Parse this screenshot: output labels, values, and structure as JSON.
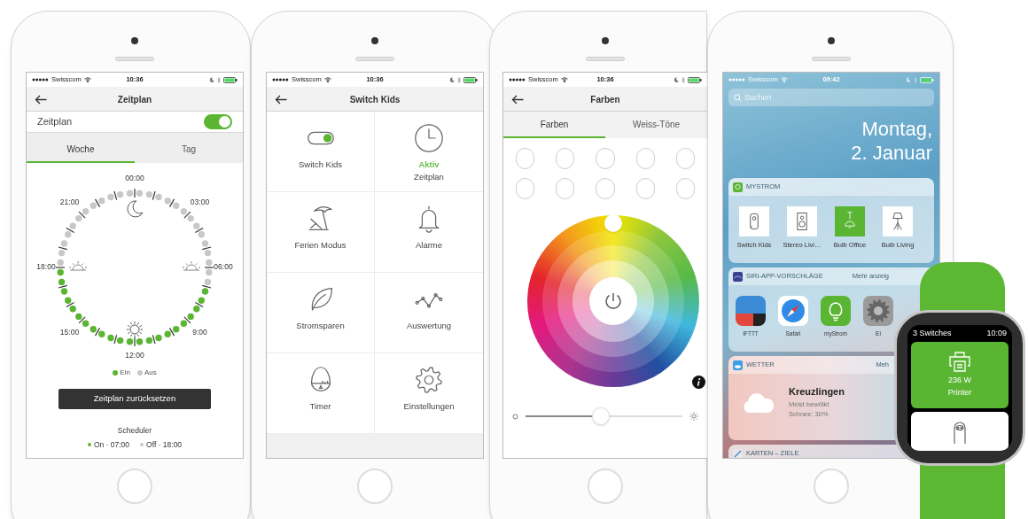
{
  "phones": [
    {
      "kind": "schedule",
      "status": {
        "carrier": "Swisscom",
        "time": "10:36"
      },
      "title": "Zeitplan",
      "toggle": {
        "label": "Zeitplan",
        "on": true
      },
      "tabs": [
        {
          "label": "Woche",
          "selected": true
        },
        {
          "label": "Tag",
          "selected": false
        }
      ],
      "clock": {
        "labels": [
          "00:00",
          "03:00",
          "06:00",
          "9:00",
          "12:00",
          "15:00",
          "18:00",
          "21:00"
        ],
        "slots": [
          false,
          false,
          false,
          false,
          false,
          false,
          false,
          false,
          false,
          false,
          false,
          false,
          false,
          false,
          true,
          true,
          true,
          true,
          true,
          true,
          true,
          true,
          true,
          true,
          true,
          true,
          true,
          true,
          true,
          true,
          true,
          true,
          true,
          true,
          true,
          true,
          false,
          false,
          false,
          false,
          false,
          false,
          false,
          false,
          false,
          false,
          false,
          false
        ]
      },
      "legend": [
        {
          "label": "Ein",
          "color": "#5ab532"
        },
        {
          "label": "Aus",
          "color": "#c8c8c8"
        }
      ],
      "reset_button": "Zeitplan zurücksetzen",
      "scheduler": {
        "title": "Scheduler",
        "entries": [
          {
            "label": "On · 07:00",
            "color": "#5ab532"
          },
          {
            "label": "Off · 18:00",
            "color": "#c8c8c8"
          }
        ]
      }
    },
    {
      "kind": "menu",
      "status": {
        "carrier": "Swisscom",
        "time": "10:36"
      },
      "title": "Switch Kids",
      "tiles": [
        {
          "kind": "toggle",
          "label": "Switch Kids",
          "on": true
        },
        {
          "kind": "clock",
          "status": "Aktiv",
          "label": "Zeitplan"
        },
        {
          "kind": "beach",
          "label": "Ferien Modus"
        },
        {
          "kind": "bell",
          "label": "Alarme"
        },
        {
          "kind": "leaf",
          "label": "Stromsparen"
        },
        {
          "kind": "chart",
          "label": "Auswertung"
        },
        {
          "kind": "timer",
          "label": "Timer"
        },
        {
          "kind": "gear",
          "label": "Einstellungen"
        }
      ]
    },
    {
      "kind": "colors",
      "status": {
        "carrier": "Swisscom",
        "time": "10:36"
      },
      "title": "Farben",
      "tabs": [
        {
          "label": "Farben",
          "selected": true
        },
        {
          "label": "Weiss-Töne",
          "selected": false
        }
      ],
      "brightness": {
        "level": 0.48
      }
    },
    {
      "kind": "today",
      "status": {
        "carrier": "Swisscom",
        "time": "09:42"
      },
      "search": {
        "placeholder": "Suchen"
      },
      "date": [
        "Montag,",
        "2. Januar"
      ],
      "widgets": [
        {
          "kind": "devices",
          "title": "MYSTROM",
          "devices": [
            {
              "label": "Switch Kids",
              "kind": "plug",
              "on": false
            },
            {
              "label": "Stereo Livi…",
              "kind": "speaker",
              "on": false
            },
            {
              "label": "Bulb Office",
              "kind": "bulb",
              "on": true
            },
            {
              "label": "Bulb Living",
              "kind": "lamp",
              "on": false
            }
          ]
        },
        {
          "kind": "apps",
          "title": "SIRI-APP-VORSCHLÄGE",
          "more": "Mehr anzeig",
          "apps": [
            {
              "label": "IFTTT",
              "kind": "ifttt"
            },
            {
              "label": "Safari",
              "kind": "safari"
            },
            {
              "label": "myStrom",
              "kind": "mystrom"
            },
            {
              "label": "Ei",
              "kind": "settings"
            }
          ]
        },
        {
          "kind": "weather",
          "title": "WETTER",
          "more": "Meh",
          "city": "Kreuzlingen",
          "lines": [
            "Meist bewölkt",
            "Schnee: 30%"
          ]
        },
        {
          "kind": "maps",
          "title": "KARTEN – ZIELE"
        }
      ]
    }
  ],
  "watch": {
    "title": "3 Switches",
    "time": "10:09",
    "cards": [
      {
        "kind": "printer",
        "reading": "236 W",
        "label": "Printer",
        "on": true
      },
      {
        "kind": "plug",
        "on": false
      }
    ]
  }
}
